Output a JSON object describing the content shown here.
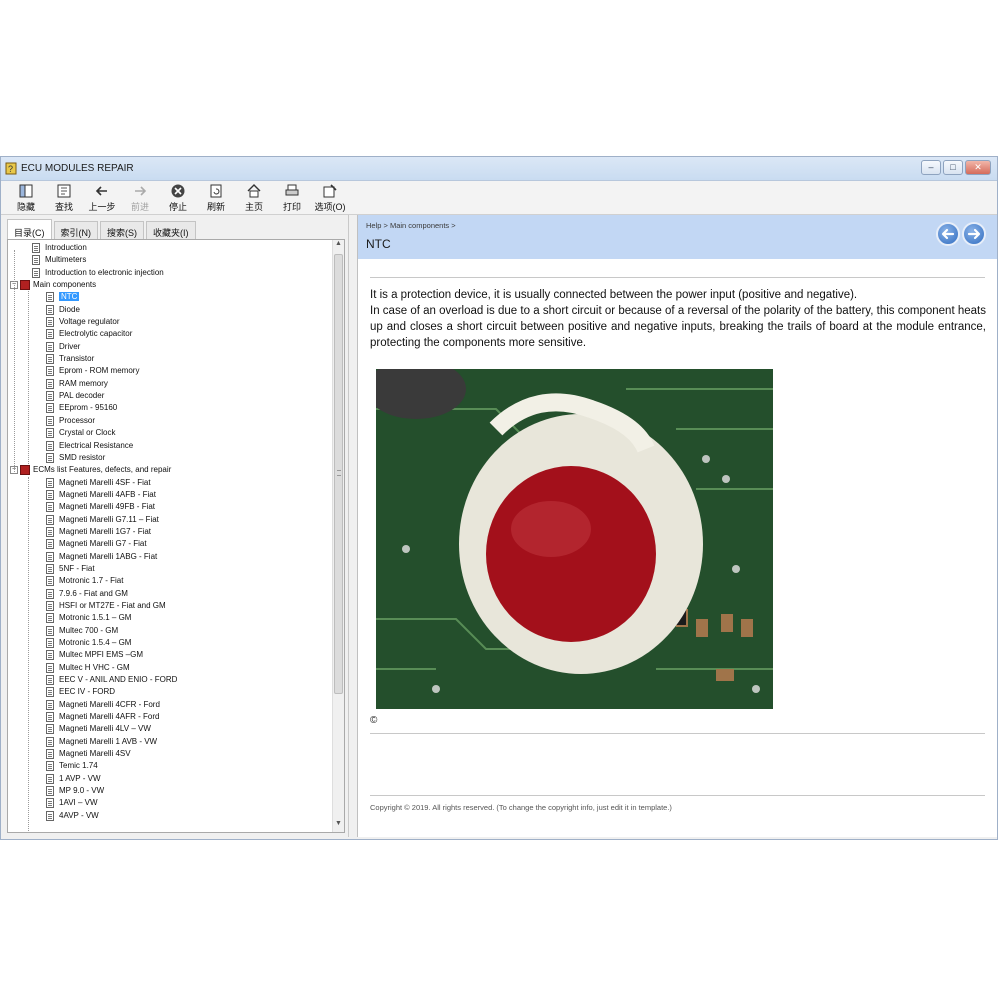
{
  "window": {
    "title": "ECU MODULES REPAIR"
  },
  "toolbar": {
    "items": [
      {
        "label": "隐藏",
        "icon": "hide-icon",
        "enabled": true
      },
      {
        "label": "查找",
        "icon": "locate-icon",
        "enabled": true
      },
      {
        "label": "上一步",
        "icon": "back-arrow-icon",
        "enabled": true
      },
      {
        "label": "前进",
        "icon": "forward-arrow-icon",
        "enabled": false
      },
      {
        "label": "停止",
        "icon": "stop-icon",
        "enabled": true
      },
      {
        "label": "刷新",
        "icon": "refresh-icon",
        "enabled": true
      },
      {
        "label": "主页",
        "icon": "home-icon",
        "enabled": true
      },
      {
        "label": "打印",
        "icon": "print-icon",
        "enabled": true
      },
      {
        "label": "选项(O)",
        "icon": "options-icon",
        "enabled": true
      }
    ]
  },
  "tabs": [
    "目录(C)",
    "索引(N)",
    "搜索(S)",
    "收藏夹(I)"
  ],
  "tree": [
    {
      "label": "Introduction",
      "level": 1,
      "type": "page"
    },
    {
      "label": "Multimeters",
      "level": 1,
      "type": "page"
    },
    {
      "label": "Introduction to electronic injection",
      "level": 1,
      "type": "page"
    },
    {
      "label": "Main components",
      "level": 0,
      "type": "book"
    },
    {
      "label": "NTC",
      "level": 2,
      "type": "page",
      "selected": true
    },
    {
      "label": "Diode",
      "level": 2,
      "type": "page"
    },
    {
      "label": "Voltage regulator",
      "level": 2,
      "type": "page"
    },
    {
      "label": "Electrolytic capacitor",
      "level": 2,
      "type": "page"
    },
    {
      "label": "Driver",
      "level": 2,
      "type": "page"
    },
    {
      "label": "Transistor",
      "level": 2,
      "type": "page"
    },
    {
      "label": "Eprom - ROM memory",
      "level": 2,
      "type": "page"
    },
    {
      "label": "RAM memory",
      "level": 2,
      "type": "page"
    },
    {
      "label": "PAL decoder",
      "level": 2,
      "type": "page"
    },
    {
      "label": "EEprom - 95160",
      "level": 2,
      "type": "page"
    },
    {
      "label": "Processor",
      "level": 2,
      "type": "page"
    },
    {
      "label": "Crystal or Clock",
      "level": 2,
      "type": "page"
    },
    {
      "label": "Electrical Resistance",
      "level": 2,
      "type": "page"
    },
    {
      "label": "SMD resistor",
      "level": 2,
      "type": "page"
    },
    {
      "label": "ECMs list Features, defects, and repair",
      "level": 0,
      "type": "book"
    },
    {
      "label": "Magneti Marelli 4SF - Fiat",
      "level": 2,
      "type": "page"
    },
    {
      "label": "Magneti Marelli 4AFB - Fiat",
      "level": 2,
      "type": "page"
    },
    {
      "label": "Magneti Marelli 49FB - Fiat",
      "level": 2,
      "type": "page"
    },
    {
      "label": "Magneti Marelli G7.11 – Fiat",
      "level": 2,
      "type": "page"
    },
    {
      "label": "Magneti Marelli 1G7 - Fiat",
      "level": 2,
      "type": "page"
    },
    {
      "label": "Magneti Marelli G7 - Fiat",
      "level": 2,
      "type": "page"
    },
    {
      "label": "Magneti Marelli 1ABG - Fiat",
      "level": 2,
      "type": "page"
    },
    {
      "label": "5NF - Fiat",
      "level": 2,
      "type": "page"
    },
    {
      "label": "Motronic 1.7 - Fiat",
      "level": 2,
      "type": "page"
    },
    {
      "label": "7.9.6 - Fiat and GM",
      "level": 2,
      "type": "page"
    },
    {
      "label": "HSFI or MT27E - Fiat and GM",
      "level": 2,
      "type": "page"
    },
    {
      "label": "Motronic 1.5.1 – GM",
      "level": 2,
      "type": "page"
    },
    {
      "label": "Multec 700 - GM",
      "level": 2,
      "type": "page"
    },
    {
      "label": "Motronic 1.5.4 – GM",
      "level": 2,
      "type": "page"
    },
    {
      "label": "Multec MPFI EMS –GM",
      "level": 2,
      "type": "page"
    },
    {
      "label": "Multec H VHC - GM",
      "level": 2,
      "type": "page"
    },
    {
      "label": "EEC V - ANIL AND ENIO - FORD",
      "level": 2,
      "type": "page"
    },
    {
      "label": "EEC IV - FORD",
      "level": 2,
      "type": "page"
    },
    {
      "label": "Magneti Marelli 4CFR - Ford",
      "level": 2,
      "type": "page"
    },
    {
      "label": "Magneti Marelli 4AFR - Ford",
      "level": 2,
      "type": "page"
    },
    {
      "label": "Magneti Marelli 4LV – VW",
      "level": 2,
      "type": "page"
    },
    {
      "label": "Magneti Marelli 1 AVB - VW",
      "level": 2,
      "type": "page"
    },
    {
      "label": "Magneti Marelli 4SV",
      "level": 2,
      "type": "page"
    },
    {
      "label": "Temic 1.74",
      "level": 2,
      "type": "page"
    },
    {
      "label": "1 AVP - VW",
      "level": 2,
      "type": "page"
    },
    {
      "label": "MP 9.0 - VW",
      "level": 2,
      "type": "page"
    },
    {
      "label": "1AVI – VW",
      "level": 2,
      "type": "page"
    },
    {
      "label": "4AVP - VW",
      "level": 2,
      "type": "page"
    }
  ],
  "content": {
    "breadcrumb": "Help > Main components >",
    "title": "NTC",
    "paragraph1": "It is a protection device, it is usually connected between the power input (positive and negative).",
    "paragraph2": "In case of an overload is due to a short circuit or because of a reversal of the polarity of the battery, this component heats up and closes a short circuit between positive and negative inputs, breaking the trails of board at the module entrance, protecting the components more sensitive.",
    "copyright_symbol": "©",
    "footer": "Copyright © 2019. All rights reserved. (To change the copyright info, just edit it in template.)"
  },
  "colors": {
    "header_bg": "#c2d7f4",
    "selection": "#3399ff",
    "nav_button": "#2f6cc0"
  }
}
